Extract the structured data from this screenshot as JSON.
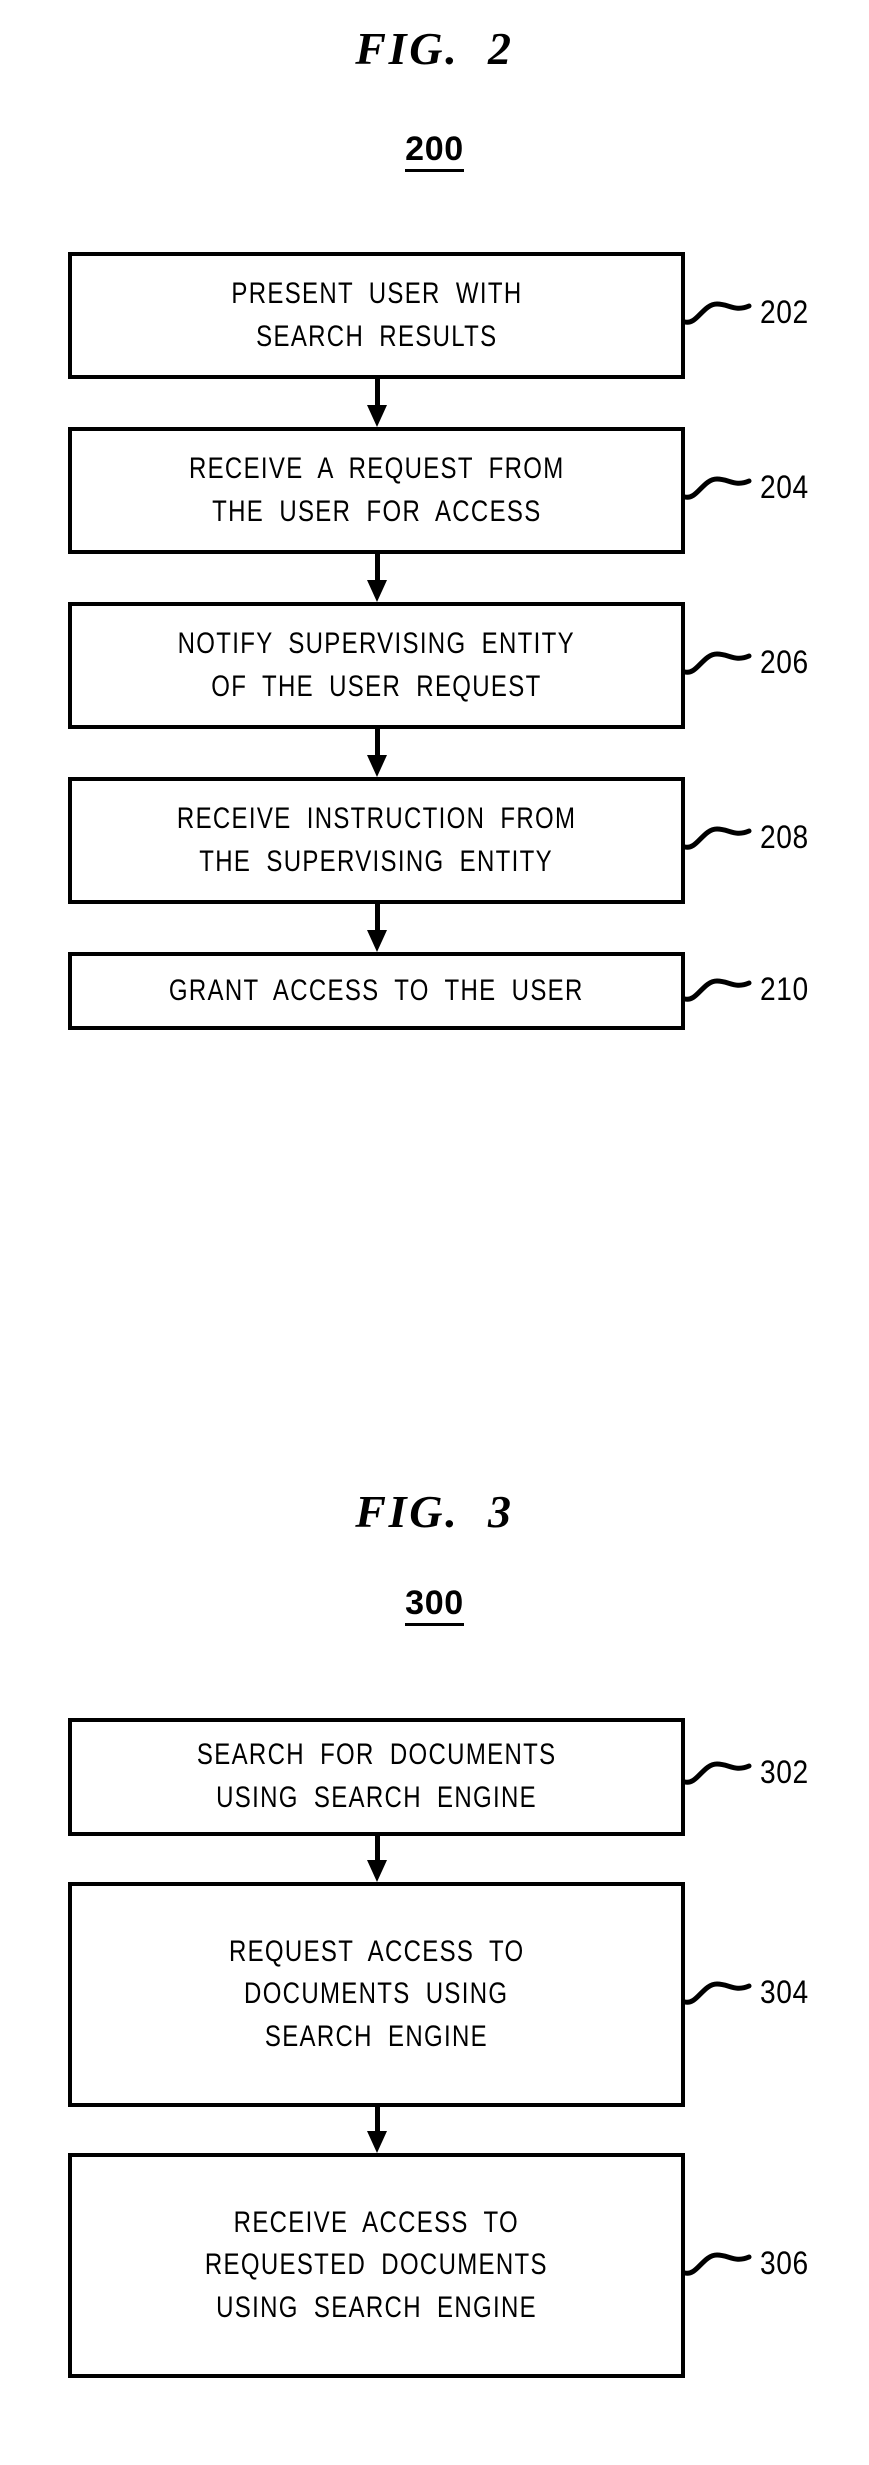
{
  "document": {
    "kind": "patent-flowchart-sheet",
    "background_color": "#ffffff",
    "ink_color": "#000000"
  },
  "figures": [
    {
      "id": "figure-2",
      "title": "FIG.  2",
      "title_word": "FIG.",
      "title_number": "2",
      "reference": "200",
      "flow": {
        "type": "flowchart",
        "direction": "top-to-bottom",
        "steps": [
          {
            "ref": "202",
            "lines": [
              "PRESENT USER WITH",
              "SEARCH RESULTS"
            ],
            "text": "PRESENT USER WITH SEARCH RESULTS"
          },
          {
            "ref": "204",
            "lines": [
              "RECEIVE A REQUEST FROM",
              "THE USER FOR ACCESS"
            ],
            "text": "RECEIVE A REQUEST FROM THE USER FOR ACCESS"
          },
          {
            "ref": "206",
            "lines": [
              "NOTIFY SUPERVISING ENTITY",
              "OF THE USER REQUEST"
            ],
            "text": "NOTIFY SUPERVISING ENTITY OF THE USER REQUEST"
          },
          {
            "ref": "208",
            "lines": [
              "RECEIVE INSTRUCTION FROM",
              "THE SUPERVISING ENTITY"
            ],
            "text": "RECEIVE INSTRUCTION FROM THE SUPERVISING ENTITY"
          },
          {
            "ref": "210",
            "lines": [
              "GRANT ACCESS TO THE USER"
            ],
            "text": "GRANT ACCESS TO THE USER"
          }
        ]
      }
    },
    {
      "id": "figure-3",
      "title": "FIG.  3",
      "title_word": "FIG.",
      "title_number": "3",
      "reference": "300",
      "flow": {
        "type": "flowchart",
        "direction": "top-to-bottom",
        "steps": [
          {
            "ref": "302",
            "lines": [
              "SEARCH FOR DOCUMENTS",
              "USING SEARCH ENGINE"
            ],
            "text": "SEARCH FOR DOCUMENTS USING SEARCH ENGINE"
          },
          {
            "ref": "304",
            "lines": [
              "REQUEST ACCESS TO",
              "DOCUMENTS USING",
              "SEARCH ENGINE"
            ],
            "text": "REQUEST ACCESS TO DOCUMENTS USING SEARCH ENGINE"
          },
          {
            "ref": "306",
            "lines": [
              "RECEIVE ACCESS TO",
              "REQUESTED DOCUMENTS",
              "USING SEARCH ENGINE"
            ],
            "text": "RECEIVE ACCESS TO REQUESTED DOCUMENTS USING SEARCH ENGINE"
          }
        ]
      }
    }
  ]
}
